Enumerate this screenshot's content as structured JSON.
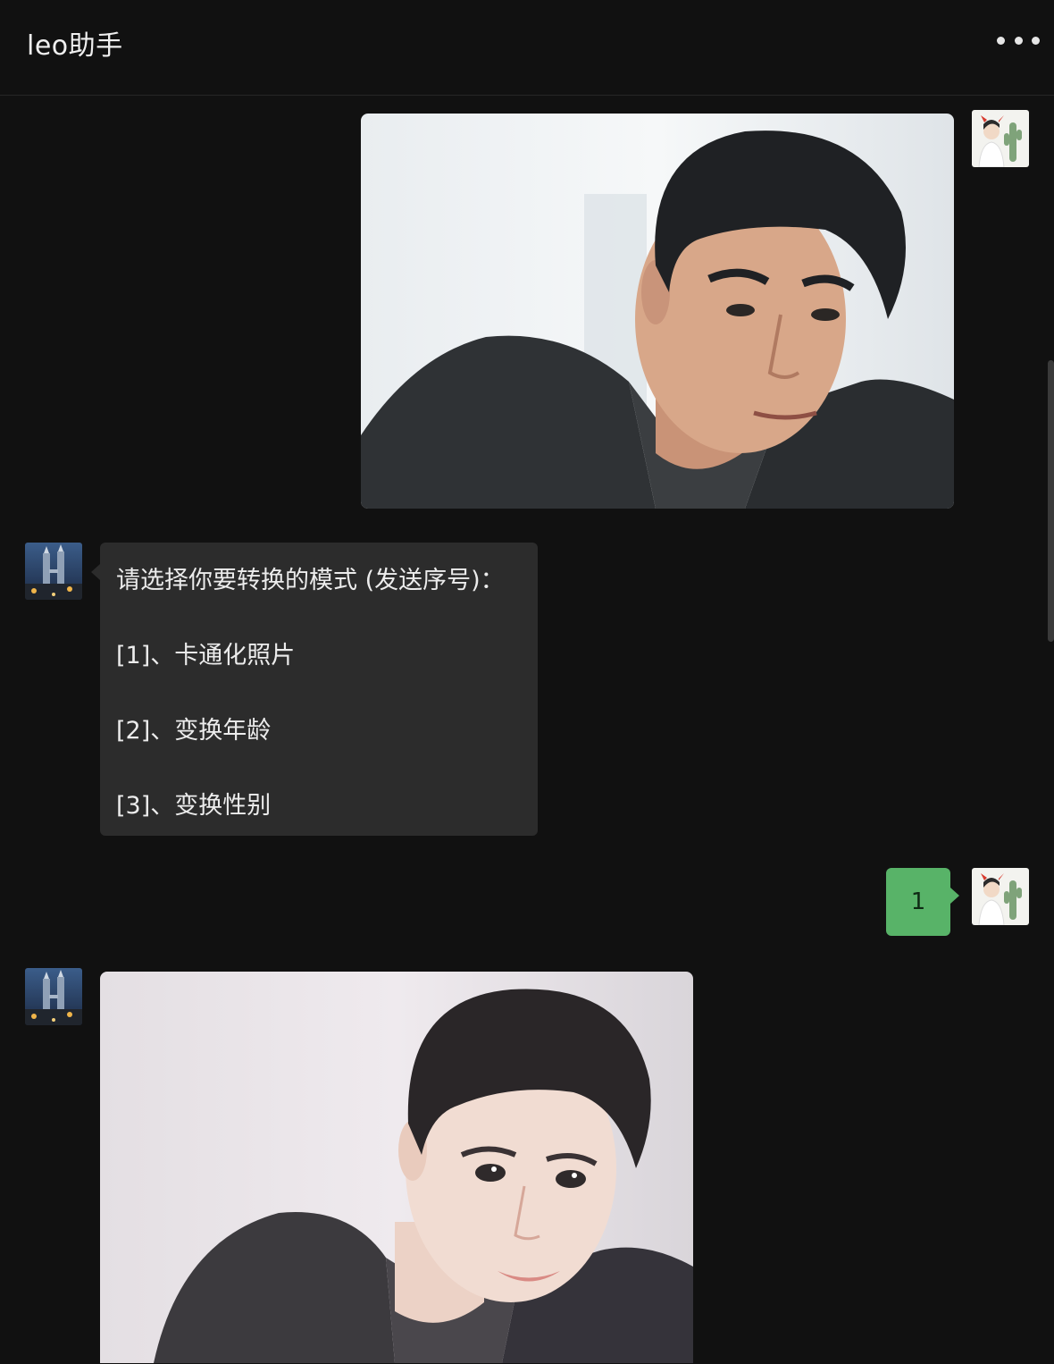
{
  "header": {
    "title": "leo助手",
    "more_icon": "more-dots-icon"
  },
  "messages": [
    {
      "sender": "user",
      "type": "image",
      "description": "photo-portrait"
    },
    {
      "sender": "bot",
      "type": "text",
      "lines": [
        "请选择你要转换的模式 (发送序号)：",
        " [1]、卡通化照片",
        "[2]、变换年龄",
        "[3]、变换性别"
      ]
    },
    {
      "sender": "user",
      "type": "text",
      "text": "1"
    },
    {
      "sender": "bot",
      "type": "image",
      "description": "cartoon-portrait"
    }
  ],
  "colors": {
    "background": "#111111",
    "bot_bubble": "#2c2c2c",
    "user_bubble": "#58b368"
  }
}
